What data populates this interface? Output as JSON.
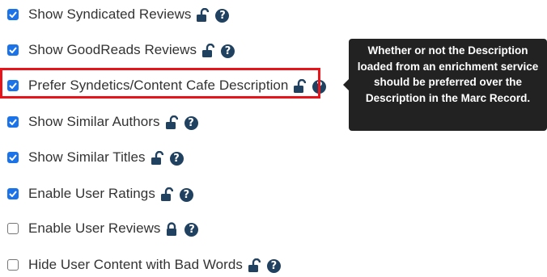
{
  "settings": [
    {
      "label": "Show Syndicated Reviews",
      "checked": true,
      "lock": "unlocked"
    },
    {
      "label": "Show GoodReads Reviews",
      "checked": true,
      "lock": "unlocked"
    },
    {
      "label": "Prefer Syndetics/Content Cafe Description",
      "checked": true,
      "lock": "unlocked",
      "highlighted": true
    },
    {
      "label": "Show Similar Authors",
      "checked": true,
      "lock": "unlocked"
    },
    {
      "label": "Show Similar Titles",
      "checked": true,
      "lock": "unlocked"
    },
    {
      "label": "Enable User Ratings",
      "checked": true,
      "lock": "unlocked"
    },
    {
      "label": "Enable User Reviews",
      "checked": false,
      "lock": "locked"
    },
    {
      "label": "Hide User Content with Bad Words",
      "checked": false,
      "lock": "unlocked"
    }
  ],
  "tooltip": {
    "text": "Whether or not the Description loaded from an enrichment service should be preferred over the Description in the Marc Record."
  },
  "icons": {
    "help": "question-circle-icon",
    "unlocked": "unlock-icon",
    "locked": "lock-icon",
    "checkbox_checked": "checkbox-checked",
    "checkbox_unchecked": "checkbox-unchecked"
  },
  "colors": {
    "checkbox": "#1a73e8",
    "icon": "#20415f",
    "highlight_border": "#e8141c",
    "tooltip_bg": "#222222",
    "label_text": "#333333"
  }
}
